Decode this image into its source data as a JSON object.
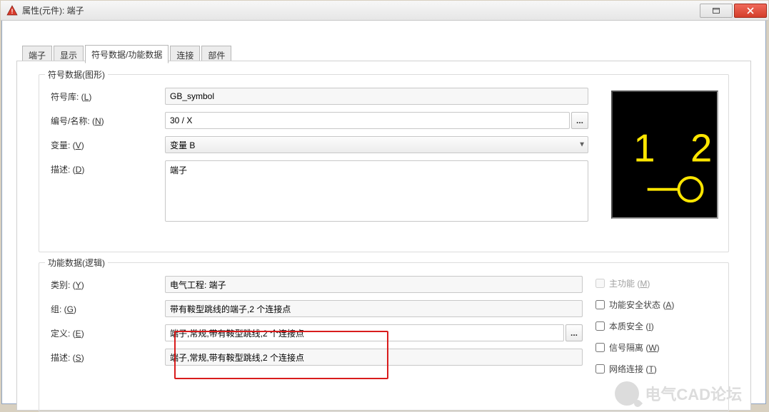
{
  "window": {
    "title": "属性(元件): 端子"
  },
  "tabs": {
    "items": [
      "端子",
      "显示",
      "符号数据/功能数据",
      "连接",
      "部件"
    ],
    "activeIndex": 2
  },
  "symbolGroup": {
    "legend": "符号数据(图形)",
    "libLabel": "符号库: (",
    "libKey": "L",
    "libLabelEnd": ")",
    "libValue": "GB_symbol",
    "numLabel": "编号/名称: (",
    "numKey": "N",
    "numLabelEnd": ")",
    "numValue": "30 / X",
    "variantLabel": "变量: (",
    "variantKey": "V",
    "variantLabelEnd": ")",
    "variantValue": "变量 B",
    "descLabel": "描述: (",
    "descKey": "D",
    "descLabelEnd": ")",
    "descValue": "端子",
    "preview": {
      "n1": "1",
      "n2": "2"
    }
  },
  "funcGroup": {
    "legend": "功能数据(逻辑)",
    "catLabel": "类别: (",
    "catKey": "Y",
    "catLabelEnd": ")",
    "catValue": "电气工程: 端子",
    "grpLabel": "组: (",
    "grpKey": "G",
    "grpLabelEnd": ")",
    "grpValue": "带有鞍型跳线的端子,2 个连接点",
    "defLabel": "定义: (",
    "defKey": "E",
    "defLabelEnd": ")",
    "defValue": "端子,常规,带有鞍型跳线,2 个连接点",
    "dscLabel": "描述: (",
    "dscKey": "S",
    "dscLabelEnd": ")",
    "dscValue": "端子,常规,带有鞍型跳线,2 个连接点",
    "checks": {
      "main": {
        "label": "主功能 (",
        "key": "M",
        "end": ")",
        "checked": false,
        "disabled": true
      },
      "safety": {
        "label": "功能安全状态 (",
        "key": "A",
        "end": ")",
        "checked": false,
        "disabled": false
      },
      "intrinsic": {
        "label": "本质安全 (",
        "key": "I",
        "end": ")",
        "checked": false,
        "disabled": false
      },
      "isol": {
        "label": "信号隔离 (",
        "key": "W",
        "end": ")",
        "checked": false,
        "disabled": false
      },
      "net": {
        "label": "网络连接 (",
        "key": "T",
        "end": ")",
        "checked": false,
        "disabled": false
      }
    }
  },
  "watermark": "电气CAD论坛"
}
